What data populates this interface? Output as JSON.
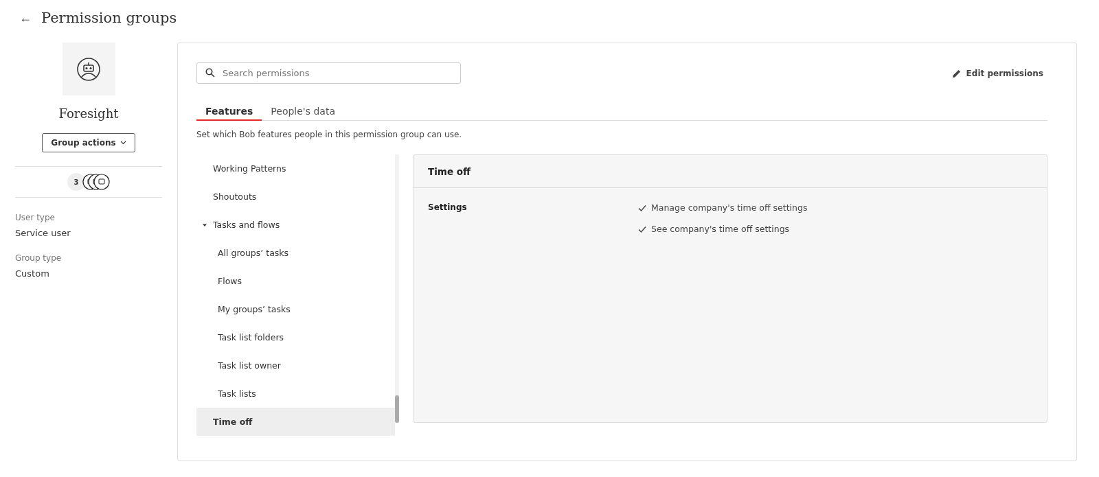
{
  "header": {
    "back": "←",
    "title": "Permission groups"
  },
  "group": {
    "name": "Foresight",
    "actions_button": "Group actions",
    "member_count": "3",
    "details": [
      {
        "label": "User type",
        "value": "Service user"
      },
      {
        "label": "Group type",
        "value": "Custom"
      }
    ]
  },
  "search": {
    "placeholder": "Search permissions"
  },
  "edit_button": "Edit permissions",
  "tabs": [
    {
      "label": "Features",
      "selected": true
    },
    {
      "label": "People's data",
      "selected": false
    }
  ],
  "description": "Set which Bob features people in this permission group can use.",
  "tree": [
    {
      "label": "Working Patterns",
      "selected": false
    },
    {
      "label": "Shoutouts",
      "selected": false
    },
    {
      "label": "Tasks and flows",
      "selected": false,
      "expanded": true,
      "children": [
        {
          "label": "All groups’ tasks",
          "selected": false
        },
        {
          "label": "Flows",
          "selected": false
        },
        {
          "label": "My groups’ tasks",
          "selected": false
        },
        {
          "label": "Task list folders",
          "selected": false
        },
        {
          "label": "Task list owner",
          "selected": false
        },
        {
          "label": "Task lists",
          "selected": false
        }
      ]
    },
    {
      "label": "Time off",
      "selected": true
    }
  ],
  "detail": {
    "title": "Time off",
    "sections": [
      {
        "label": "Settings",
        "permissions": [
          {
            "text": "Manage company's time off settings",
            "checked": true
          },
          {
            "text": "See company's time off settings",
            "checked": true
          }
        ]
      }
    ]
  }
}
